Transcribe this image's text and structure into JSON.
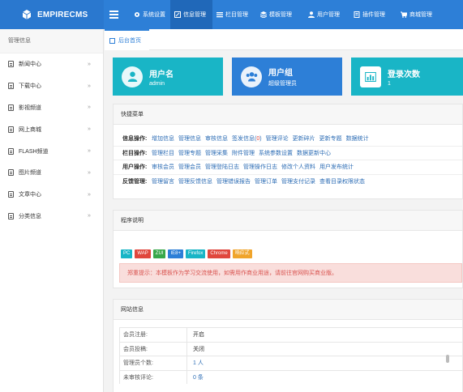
{
  "app": {
    "title": "EMPIRECMS"
  },
  "topnav": [
    {
      "label": "系统设置",
      "icon": "gear-icon"
    },
    {
      "label": "信息管理",
      "icon": "edit-icon",
      "active": true
    },
    {
      "label": "栏目管理",
      "icon": "list-icon"
    },
    {
      "label": "模板管理",
      "icon": "layers-icon"
    },
    {
      "label": "用户管理",
      "icon": "user-icon"
    },
    {
      "label": "插件管理",
      "icon": "plugin-icon"
    },
    {
      "label": "商城管理",
      "icon": "cart-icon"
    }
  ],
  "sidebar": {
    "title": "管理信息",
    "items": [
      {
        "label": "新闻中心"
      },
      {
        "label": "下载中心"
      },
      {
        "label": "影视频道"
      },
      {
        "label": "网上商城"
      },
      {
        "label": "FLASH频道"
      },
      {
        "label": "图片频道"
      },
      {
        "label": "文章中心"
      },
      {
        "label": "分类信息"
      }
    ]
  },
  "tab": {
    "label": "后台首页"
  },
  "cards": [
    {
      "title": "用户名",
      "value": "admin",
      "icon": "user-icon",
      "color": "#19b5c6"
    },
    {
      "title": "用户组",
      "value": "超级管理员",
      "icon": "group-icon",
      "color": "#2d7fd7"
    },
    {
      "title": "登录次数",
      "value": "1",
      "icon": "chart-icon",
      "color": "#19b5c6"
    }
  ],
  "quick": {
    "title": "快捷菜单",
    "rows": [
      {
        "label": "信息操作:",
        "links": [
          "增加信息",
          "管理信息",
          "审核信息",
          "签发信息(0)",
          "管理评论",
          "更新碎片",
          "更新专题",
          "数据统计"
        ]
      },
      {
        "label": "栏目操作:",
        "links": [
          "管理栏目",
          "管理专题",
          "管理采集",
          "附件管理",
          "系统参数设置",
          "数据更新中心"
        ]
      },
      {
        "label": "用户操作:",
        "links": [
          "审核会员",
          "管理会员",
          "管理登陆日志",
          "管理操作日志",
          "修改个人资料",
          "用户发布统计"
        ]
      },
      {
        "label": "反馈管理:",
        "links": [
          "管理留言",
          "管理反馈信息",
          "管理错误报告",
          "管理订单",
          "管理支付记录",
          "查看目录权限状态"
        ]
      }
    ]
  },
  "program": {
    "title": "程序说明",
    "badges": [
      {
        "label": "PC",
        "color": "#19b5c6"
      },
      {
        "label": "WAP",
        "color": "#e0473d"
      },
      {
        "label": "ZUI",
        "color": "#38a84a"
      },
      {
        "label": "IE8+",
        "color": "#2d7fd7"
      },
      {
        "label": "Firefox",
        "color": "#19b5c6"
      },
      {
        "label": "Chrome",
        "color": "#e0473d"
      },
      {
        "label": "响应式",
        "color": "#f0a42b"
      }
    ],
    "notice": "郑重提示：本模板作为学习交流使用，如需用作商业用途，请前往官网购买商业版。"
  },
  "site": {
    "title": "网站信息",
    "rows": [
      {
        "k": "会员注册:",
        "v": "开启"
      },
      {
        "k": "会员投稿:",
        "v": "关闭"
      },
      {
        "k": "管理员个数:",
        "v": "1 人"
      },
      {
        "k": "未审核评论:",
        "v": "0 条"
      }
    ]
  }
}
